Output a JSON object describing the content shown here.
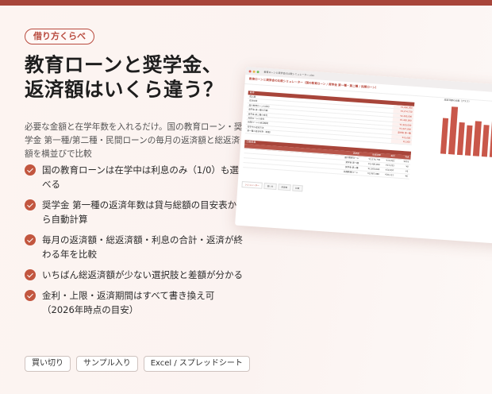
{
  "badge": "借り方くらべ",
  "headline": [
    "教育ローンと奨学金、",
    "返済額はいくら違う？"
  ],
  "lead": "必要な金額と在学年数を入れるだけ。国の教育ローン・奨学金 第一種/第二種・民間ローンの毎月の返済額と総返済額を横並びで比較",
  "features": [
    "国の教育ローンは在学中は利息のみ（1/0）も選べる",
    "奨学金 第一種の返済年数は貸与総額の目安表から自動計算",
    "毎月の返済額・総返済額・利息の合計・返済が終わる年を比較",
    "いちばん総返済額が少ない選択肢と差額が分かる",
    "金利・上限・返済期間はすべて書き換え可（2026年時点の目安）"
  ],
  "tags": [
    "買い切り",
    "サンプル入り",
    "Excel / スプレッドシート"
  ],
  "colors": {
    "accent": "#b84a3e",
    "top_bar": "#a8453a",
    "check": "#c2563f"
  },
  "icons": {
    "feature_bullet": "check-circle-icon"
  },
  "sheet": {
    "window_title": "教育ローンと奨学金の比較シミュレーター.xlsx",
    "heading": "教育ローンと奨学金の比較シミュレーター（国の教育ローン / 奨学金 第一種・第二種 / 民間ローン）",
    "input_header": "条件",
    "inputs": [
      {
        "label": "借入額",
        "value": "¥1,800,000"
      },
      {
        "label": "在学年数",
        "value": "¥3,274,730"
      },
      {
        "label": "国の教育ローンの金利",
        "value": "¥2,400,000"
      },
      {
        "label": "奨学金 第一種の月額",
        "value": "¥2,400,000"
      },
      {
        "label": "奨学金 第二種の金利",
        "value": "¥2,400,000"
      },
      {
        "label": "民間ローンの金利",
        "value": "¥1,847,000"
      },
      {
        "label": "民間ローンの返済期間",
        "value": "奨学金 第一種"
      },
      {
        "label": "在学中の返済方法",
        "value": "¥15,000"
      },
      {
        "label": "第一種の返済年数（自動）",
        "value": "¥2,500"
      }
    ],
    "result_header": "比較結果",
    "result_columns": [
      "選択肢",
      "総返済額",
      "毎月",
      "利息"
    ],
    "results": [
      {
        "name": "国の教育ローン",
        "total": "¥3,274,730",
        "monthly": "¥13,961",
        "interest": "¥474"
      },
      {
        "name": "奨学金 第一種",
        "total": "¥2,400,000",
        "monthly": "¥13,333",
        "interest": "¥0"
      },
      {
        "name": "奨学金 第二種",
        "total": "¥2,500,000",
        "monthly": "¥14,997",
        "interest": "¥5"
      },
      {
        "name": "民間教育ローン",
        "total": "¥3,967,980",
        "monthly": "¥20,151",
        "interest": "¥6"
      }
    ],
    "sheet_tabs": [
      "シミュレーター",
      "使い方",
      "目安表",
      "比較"
    ],
    "chart_title": "総返済額の比較（グラフ）",
    "chart_values": [
      75,
      100,
      68,
      64,
      74,
      66,
      75,
      64,
      70
    ]
  }
}
